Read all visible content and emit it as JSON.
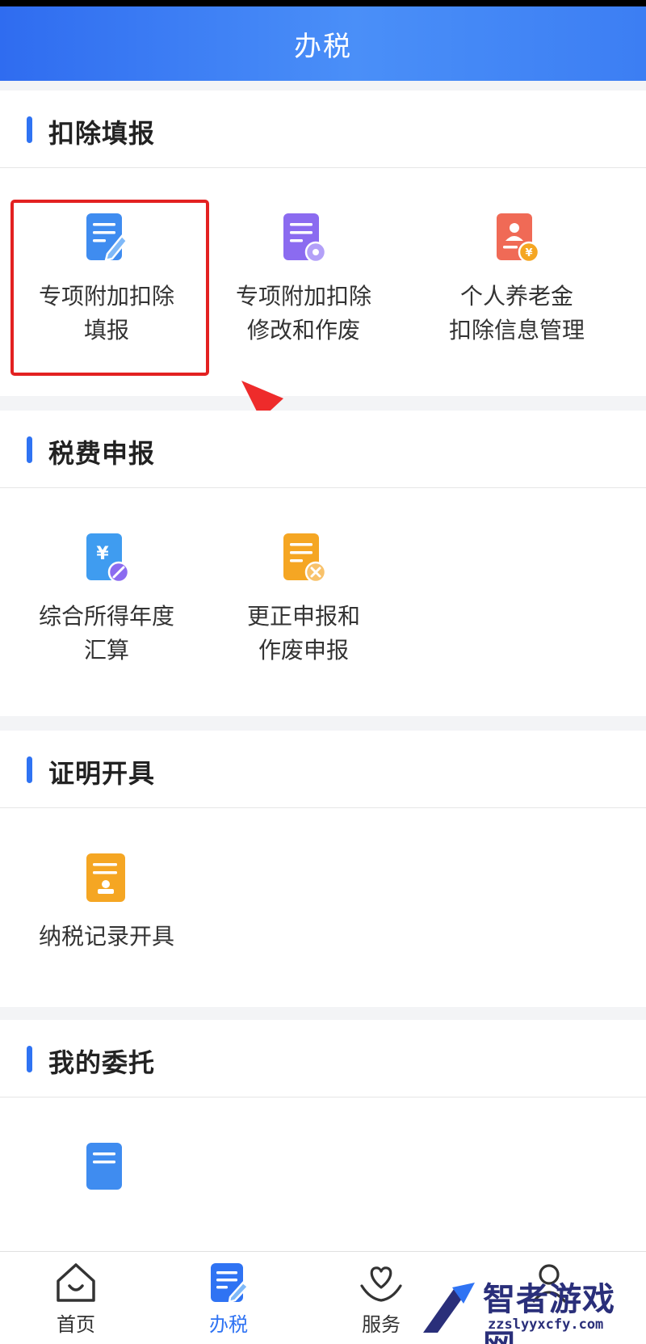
{
  "header": {
    "title": "办税"
  },
  "sections": {
    "deduction": {
      "title": "扣除填报",
      "items": [
        {
          "line1": "专项附加扣除",
          "line2": "填报",
          "icon": "document-edit-icon",
          "color": "#3f8cf0"
        },
        {
          "line1": "专项附加扣除",
          "line2": "修改和作废",
          "icon": "document-settings-icon",
          "color": "#8b6bf0"
        },
        {
          "line1": "个人养老金",
          "line2": "扣除信息管理",
          "icon": "pension-card-icon",
          "color": "#f06a56"
        }
      ]
    },
    "declaration": {
      "title": "税费申报",
      "items": [
        {
          "line1": "综合所得年度",
          "line2": "汇算",
          "icon": "yuan-document-icon",
          "color": "#3f9cf0"
        },
        {
          "line1": "更正申报和",
          "line2": "作废申报",
          "icon": "document-cancel-icon",
          "color": "#f5a623"
        }
      ]
    },
    "certificate": {
      "title": "证明开具",
      "items": [
        {
          "line1": "纳税记录开具",
          "line2": "",
          "icon": "document-stamp-icon",
          "color": "#f5a623"
        }
      ]
    },
    "entrust": {
      "title": "我的委托",
      "items": [
        {
          "icon": "document-list-icon",
          "color": "#3f8cf0"
        }
      ]
    }
  },
  "tabbar": {
    "items": [
      {
        "label": "首页",
        "icon": "home-icon",
        "active": false
      },
      {
        "label": "办税",
        "icon": "tax-document-icon",
        "active": true
      },
      {
        "label": "服务",
        "icon": "heart-hands-icon",
        "active": false
      },
      {
        "label": "",
        "icon": "user-icon",
        "active": false
      }
    ]
  },
  "watermark": {
    "name": "智者游戏网",
    "url": "zzslyyxcfy.com"
  },
  "colors": {
    "primary": "#2f73f3",
    "highlight": "#e32121"
  }
}
